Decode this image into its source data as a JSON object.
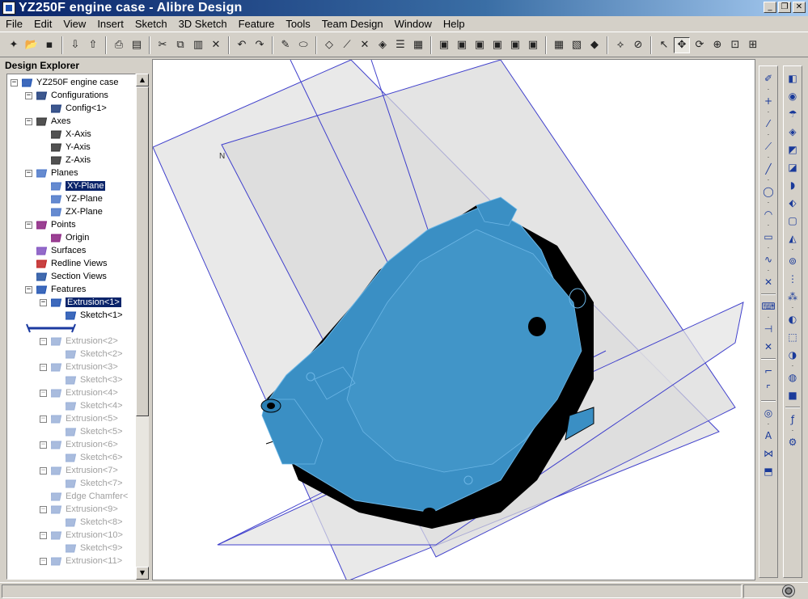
{
  "window": {
    "title": "YZ250F engine case - Alibre Design"
  },
  "menubar": {
    "items": [
      "File",
      "Edit",
      "View",
      "Insert",
      "Sketch",
      "3D Sketch",
      "Feature",
      "Tools",
      "Team Design",
      "Window",
      "Help"
    ]
  },
  "explorer": {
    "header": "Design Explorer",
    "tree": [
      {
        "label": "YZ250F engine case",
        "indent": 0,
        "expander": "−",
        "icon": "part-icon",
        "state": "normal"
      },
      {
        "label": "Configurations",
        "indent": 1,
        "expander": "−",
        "icon": "table-icon",
        "state": "normal"
      },
      {
        "label": "Config<1>",
        "indent": 2,
        "expander": "",
        "icon": "table-icon",
        "state": "normal"
      },
      {
        "label": "Axes",
        "indent": 1,
        "expander": "−",
        "icon": "axis-icon",
        "state": "normal"
      },
      {
        "label": "X-Axis",
        "indent": 2,
        "expander": "",
        "icon": "axis-icon",
        "state": "normal"
      },
      {
        "label": "Y-Axis",
        "indent": 2,
        "expander": "",
        "icon": "axis-icon",
        "state": "normal"
      },
      {
        "label": "Z-Axis",
        "indent": 2,
        "expander": "",
        "icon": "axis-icon",
        "state": "normal"
      },
      {
        "label": "Planes",
        "indent": 1,
        "expander": "−",
        "icon": "plane-icon",
        "state": "normal"
      },
      {
        "label": "XY-Plane",
        "indent": 2,
        "expander": "",
        "icon": "plane-icon",
        "state": "selected"
      },
      {
        "label": "YZ-Plane",
        "indent": 2,
        "expander": "",
        "icon": "plane-icon",
        "state": "normal"
      },
      {
        "label": "ZX-Plane",
        "indent": 2,
        "expander": "",
        "icon": "plane-icon",
        "state": "normal"
      },
      {
        "label": "Points",
        "indent": 1,
        "expander": "−",
        "icon": "point-icon",
        "state": "normal"
      },
      {
        "label": "Origin",
        "indent": 2,
        "expander": "",
        "icon": "point-icon",
        "state": "normal"
      },
      {
        "label": "Surfaces",
        "indent": 1,
        "expander": "",
        "icon": "surface-icon",
        "state": "normal"
      },
      {
        "label": "Redline Views",
        "indent": 1,
        "expander": "",
        "icon": "redline-icon",
        "state": "normal"
      },
      {
        "label": "Section Views",
        "indent": 1,
        "expander": "",
        "icon": "section-icon",
        "state": "normal"
      },
      {
        "label": "Features",
        "indent": 1,
        "expander": "−",
        "icon": "feature-icon",
        "state": "normal"
      },
      {
        "label": "Extrusion<1>",
        "indent": 2,
        "expander": "−",
        "icon": "extrude-icon",
        "state": "selected"
      },
      {
        "label": "Sketch<1>",
        "indent": 3,
        "expander": "",
        "icon": "sketch-icon",
        "state": "normal"
      },
      {
        "label": "",
        "indent": 1,
        "expander": "",
        "icon": "rollback-bar",
        "state": "rollback"
      },
      {
        "label": "Extrusion<2>",
        "indent": 2,
        "expander": "−",
        "icon": "extrude-icon",
        "state": "dim"
      },
      {
        "label": "Sketch<2>",
        "indent": 3,
        "expander": "",
        "icon": "sketch-icon",
        "state": "dim"
      },
      {
        "label": "Extrusion<3>",
        "indent": 2,
        "expander": "−",
        "icon": "extrude-icon",
        "state": "dim"
      },
      {
        "label": "Sketch<3>",
        "indent": 3,
        "expander": "",
        "icon": "sketch-icon",
        "state": "dim"
      },
      {
        "label": "Extrusion<4>",
        "indent": 2,
        "expander": "−",
        "icon": "extrude-icon",
        "state": "dim"
      },
      {
        "label": "Sketch<4>",
        "indent": 3,
        "expander": "",
        "icon": "sketch-icon",
        "state": "dim"
      },
      {
        "label": "Extrusion<5>",
        "indent": 2,
        "expander": "−",
        "icon": "extrude-icon",
        "state": "dim"
      },
      {
        "label": "Sketch<5>",
        "indent": 3,
        "expander": "",
        "icon": "sketch-icon",
        "state": "dim"
      },
      {
        "label": "Extrusion<6>",
        "indent": 2,
        "expander": "−",
        "icon": "extrude-icon",
        "state": "dim"
      },
      {
        "label": "Sketch<6>",
        "indent": 3,
        "expander": "",
        "icon": "sketch-icon",
        "state": "dim"
      },
      {
        "label": "Extrusion<7>",
        "indent": 2,
        "expander": "−",
        "icon": "extrude-icon",
        "state": "dim"
      },
      {
        "label": "Sketch<7>",
        "indent": 3,
        "expander": "",
        "icon": "sketch-icon",
        "state": "dim"
      },
      {
        "label": "Edge Chamfer<",
        "indent": 2,
        "expander": "",
        "icon": "chamfer-icon",
        "state": "dim"
      },
      {
        "label": "Extrusion<9>",
        "indent": 2,
        "expander": "−",
        "icon": "extrude-icon",
        "state": "dim"
      },
      {
        "label": "Sketch<8>",
        "indent": 3,
        "expander": "",
        "icon": "sketch-icon",
        "state": "dim"
      },
      {
        "label": "Extrusion<10>",
        "indent": 2,
        "expander": "−",
        "icon": "extrude-icon",
        "state": "dim"
      },
      {
        "label": "Sketch<9>",
        "indent": 3,
        "expander": "",
        "icon": "sketch-icon",
        "state": "dim"
      },
      {
        "label": "Extrusion<11>",
        "indent": 2,
        "expander": "−",
        "icon": "extrude-icon",
        "state": "dim"
      }
    ]
  },
  "toolbar": {
    "buttons": [
      "new-icon",
      "open-icon",
      "save-icon",
      "|",
      "check-in-icon",
      "check-out-icon",
      "|",
      "print-icon",
      "pdf-icon",
      "|",
      "cut-icon",
      "copy-icon",
      "paste-icon",
      "delete-icon",
      "|",
      "undo-icon",
      "redo-icon",
      "|",
      "redline-icon",
      "ellipse-icon",
      "|",
      "plane-icon",
      "axis-icon",
      "point-icon",
      "surface-icon",
      "list-icon",
      "table-icon",
      "|",
      "front-view-icon",
      "back-view-icon",
      "left-view-icon",
      "right-view-icon",
      "top-view-icon",
      "bottom-view-icon",
      "|",
      "wireframe-icon",
      "hidden-icon",
      "shaded-icon",
      "|",
      "measure-icon",
      "section-icon",
      "|",
      "select-icon",
      "pan-icon",
      "rotate-icon",
      "zoom-icon",
      "zoom-window-icon",
      "zoom-fit-icon"
    ]
  },
  "right_tools": {
    "left": [
      "sketch-icon",
      "dot",
      "line-add-icon",
      "dot",
      "dim-line-icon",
      "dot",
      "construct-icon",
      "dot",
      "line-icon",
      "dot",
      "circle-icon",
      "dot",
      "arc-icon",
      "dot",
      "rectangle-icon",
      "dot",
      "spline-icon",
      "dot",
      "point-icon",
      "|",
      "keyboard-icon",
      "dot",
      "trim-icon",
      "extend-icon",
      "|",
      "fillet-icon",
      "chamfer-icon",
      "|",
      "offset-icon",
      "dot",
      "text-icon",
      "mirror-icon",
      "project-icon"
    ],
    "right": [
      "extrude-icon",
      "revolve-icon",
      "sweep-icon",
      "loft-icon",
      "cut-extrude-icon",
      "cut-revolve-icon",
      "fillet-3d-icon",
      "chamfer-3d-icon",
      "shell-icon",
      "draft-icon",
      "dot",
      "hole-icon",
      "rib-icon",
      "pattern-icon",
      "dot",
      "mirror-3d-icon",
      "scale-icon",
      "split-icon",
      "dot",
      "boolean-icon",
      "thicken-icon",
      "|",
      "equation-icon",
      "dot",
      "property-icon"
    ]
  },
  "colors": {
    "part": "#3a8fc4",
    "part_dark": "#000000",
    "plane_fill": "#e8e8e8",
    "plane_edge": "#3333cc",
    "titlebar": "#0a246a"
  },
  "status": {
    "text": ""
  }
}
